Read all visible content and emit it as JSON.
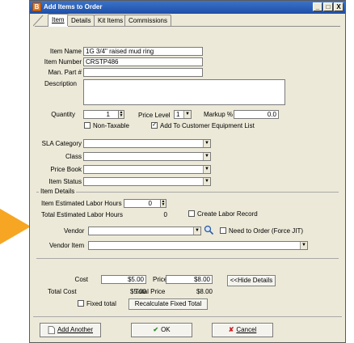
{
  "window": {
    "title": "Add Items to Order",
    "app_icon": "app-logo-icon",
    "controls": [
      "_",
      "□",
      "X"
    ]
  },
  "tabs": [
    {
      "label": "Item",
      "active": true
    },
    {
      "label": "Details",
      "active": false
    },
    {
      "label": "Kit Items",
      "active": false
    },
    {
      "label": "Commissions",
      "active": false
    }
  ],
  "item": {
    "name_label": "Item Name",
    "name_value": "1G 3/4\" raised mud ring",
    "number_label": "Item Number",
    "number_value": "CRSTP486",
    "manpart_label": "Man. Part #",
    "manpart_value": "",
    "description_label": "Description",
    "description_value": ""
  },
  "quantity": {
    "label": "Quantity",
    "value": "1",
    "price_level_label": "Price Level",
    "price_level_value": "1",
    "markup_label": "Markup %",
    "markup_value": "0.0",
    "non_taxable_label": "Non-Taxable",
    "non_taxable_checked": false,
    "add_equip_label": "Add To Customer Equipment List",
    "add_equip_checked": true
  },
  "classification": {
    "sla_label": "SLA Category",
    "class_label": "Class",
    "pricebook_label": "Price Book",
    "status_label": "Item Status"
  },
  "details": {
    "group_label": "Item Details",
    "est_labor_label": "Item Estimated Labor Hours",
    "est_labor_value": "0",
    "total_labor_label": "Total Estimated Labor Hours",
    "total_labor_value": "0",
    "create_labor_label": "Create Labor Record",
    "vendor_label": "Vendor",
    "need_order_label": "Need to Order (Force JIT)",
    "vendor_item_label": "Vendor Item"
  },
  "pricing": {
    "cost_label": "Cost",
    "cost_value": "$5.00",
    "price_label": "Price",
    "price_value": "$8.00",
    "hide_details_label": "<<Hide Details",
    "total_cost_label": "Total Cost",
    "total_cost_value": "$5.00",
    "total_price_label": "Total Price",
    "total_price_value": "$8.00",
    "fixed_total_label": "Fixed total",
    "recalc_label": "Recalculate Fixed Total"
  },
  "buttons": {
    "add_another_label": "Add Another",
    "ok_label": "OK",
    "cancel_label": "Cancel"
  },
  "colors": {
    "titlebar": "#1d4fa8",
    "window_bg": "#ece9d8",
    "arrow": "#f6a623",
    "ok_check": "#2e8b2e",
    "cancel_x": "#cc1f1f"
  }
}
